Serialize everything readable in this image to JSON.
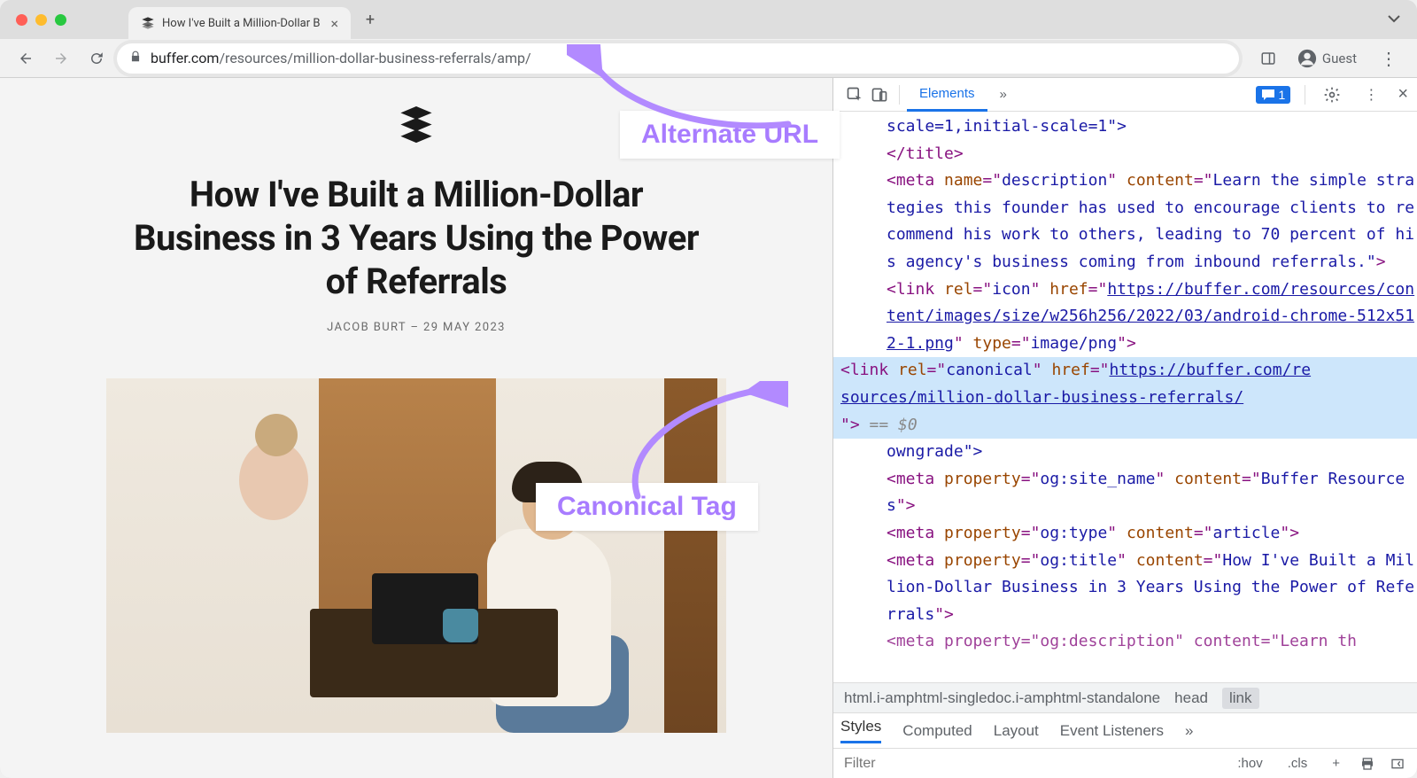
{
  "window": {
    "tab_title": "How I've Built a Million-Dollar B",
    "new_tab_label": "+",
    "menu_arrow": "v"
  },
  "toolbar": {
    "url_host": "buffer.com",
    "url_path": "/resources/million-dollar-business-referrals/amp/",
    "guest_label": "Guest"
  },
  "article": {
    "title": "How I've Built a Million-Dollar Business in 3 Years Using the Power of Referrals",
    "byline": "JACOB BURT – 29 MAY 2023"
  },
  "annotations": {
    "alternate_url": "Alternate URL",
    "canonical_tag": "Canonical Tag"
  },
  "devtools": {
    "tabs": {
      "elements": "Elements",
      "more": "»"
    },
    "issues_count": "1",
    "source": {
      "l1": "scale=1,initial-scale=1\">",
      "l2": "</title>",
      "meta_desc_name": "description",
      "meta_desc_content": "Learn the simple strategies this founder has used to encourage clients to recommend his work to others, leading to 70 percent of his agency's business coming from inbound referrals.\"",
      "link_icon_href": "https://buffer.com/resources/content/images/size/w256h256/2022/03/android-chrome-512x512-1.png",
      "link_icon_type": "image/png",
      "canonical_href_1": "https://buffer.com/re",
      "canonical_href_2": "sources/million-dollar-business-referrals/",
      "eq_zero": " == $0",
      "owngrade": "owngrade\">",
      "og_sitename_val": "Buffer Resources",
      "og_type_val": "article",
      "og_title_val": "How I've Built a Million-Dollar Business in 3 Years Using the Power of Referrals",
      "og_desc_prefix": "<meta property=\"og:description\" content=\"Learn th"
    },
    "breadcrumb": {
      "b1": "html.i-amphtml-singledoc.i-amphtml-standalone",
      "b2": "head",
      "b3": "link"
    },
    "style_tabs": {
      "styles": "Styles",
      "computed": "Computed",
      "layout": "Layout",
      "listeners": "Event Listeners",
      "more": "»"
    },
    "filter": {
      "placeholder": "Filter",
      "hov": ":hov",
      "cls": ".cls",
      "plus": "+"
    }
  }
}
